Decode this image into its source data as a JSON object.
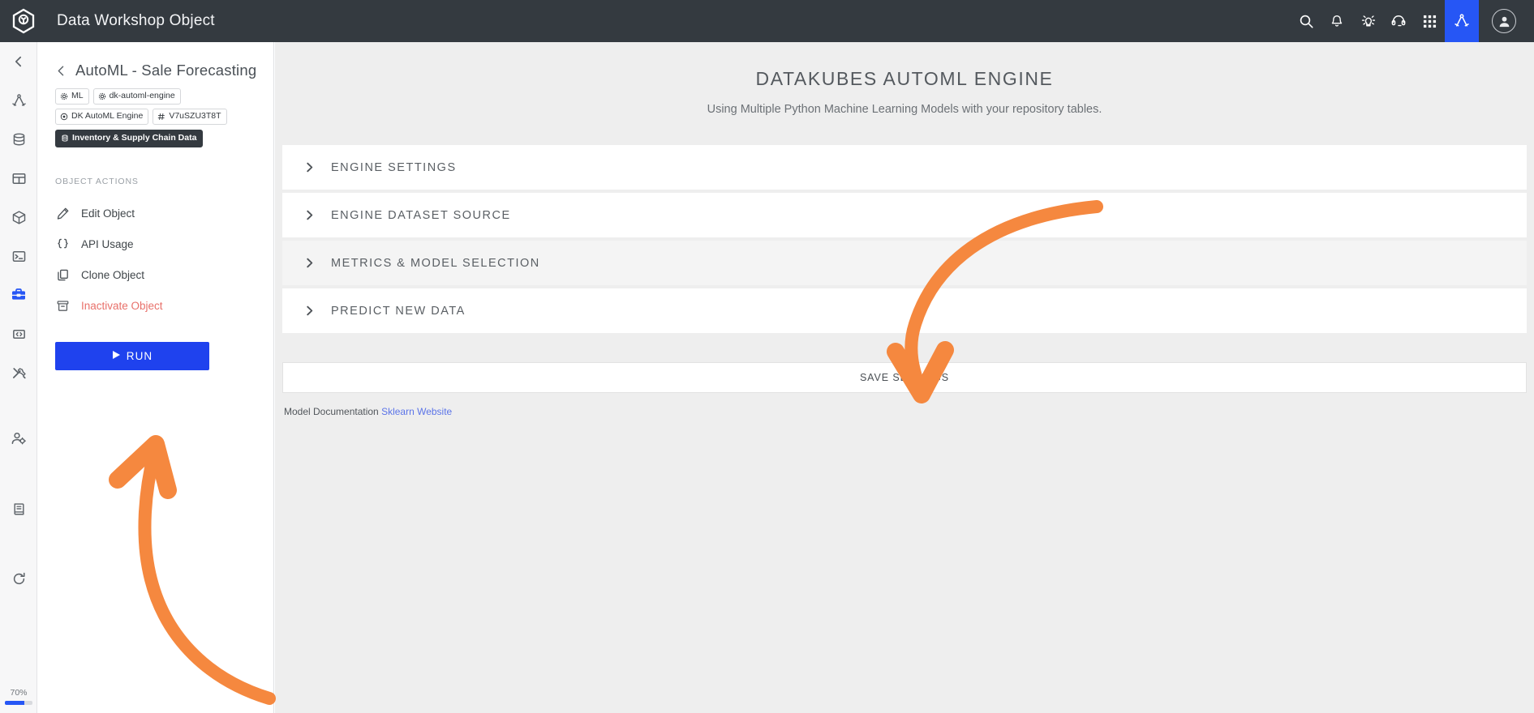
{
  "topbar": {
    "title": "Data Workshop Object",
    "logo_icon": "hexagon-logo-icon",
    "icons": [
      {
        "name": "search-icon",
        "label": "Search"
      },
      {
        "name": "bell-icon",
        "label": "Notifications"
      },
      {
        "name": "lightbulb-idea-icon",
        "label": "Ideas"
      },
      {
        "name": "headset-support-icon",
        "label": "Support"
      },
      {
        "name": "grid-apps-icon",
        "label": "Apps"
      },
      {
        "name": "compass-drafting-icon",
        "label": "Workshop"
      }
    ],
    "avatar_icon": "user-avatar-icon"
  },
  "rail": {
    "items": [
      {
        "name": "collapse-back-icon",
        "label": "Collapse"
      },
      {
        "name": "compass-drafting-icon",
        "label": "Designer"
      },
      {
        "name": "database-icon",
        "label": "Databases"
      },
      {
        "name": "table-icon",
        "label": "Tables"
      },
      {
        "name": "cube-icon",
        "label": "Objects"
      },
      {
        "name": "terminal-icon",
        "label": "Terminal"
      },
      {
        "name": "toolbox-icon",
        "label": "Workshop",
        "active": true
      },
      {
        "name": "code-brackets-icon",
        "label": "Code"
      },
      {
        "name": "tools-icon",
        "label": "Tools"
      },
      {
        "name": "user-settings-icon",
        "label": "User Settings"
      },
      {
        "name": "book-icon",
        "label": "Documentation"
      },
      {
        "name": "refresh-icon",
        "label": "Refresh"
      }
    ],
    "progress_label": "70%",
    "progress_value": 70,
    "progress_color": "#2656f5"
  },
  "panel": {
    "back_icon": "chevron-left-icon",
    "title": "AutoML - Sale Forecasting",
    "tags": [
      {
        "icon": "gear-icon",
        "label": "ML",
        "style": "light"
      },
      {
        "icon": "gear-icon",
        "label": "dk-automl-engine",
        "style": "light"
      },
      {
        "icon": "target-icon",
        "label": "DK AutoML Engine",
        "style": "light"
      },
      {
        "icon": "hash-icon",
        "label": "V7uSZU3T8T",
        "style": "light"
      },
      {
        "icon": "database-icon",
        "label": "Inventory & Supply Chain Data",
        "style": "dark"
      }
    ],
    "section_label": "OBJECT ACTIONS",
    "actions": [
      {
        "icon": "pencil-icon",
        "label": "Edit Object",
        "danger": false
      },
      {
        "icon": "braces-icon",
        "label": "API Usage",
        "danger": false
      },
      {
        "icon": "copy-icon",
        "label": "Clone Object",
        "danger": false
      },
      {
        "icon": "archive-icon",
        "label": "Inactivate Object",
        "danger": true
      }
    ],
    "run_button": {
      "label": "RUN",
      "icon": "play-icon",
      "color": "#1f42ee"
    }
  },
  "main": {
    "title": "DATAKUBES AUTOML ENGINE",
    "subtitle": "Using Multiple Python Machine Learning Models with your repository tables.",
    "accordion": [
      {
        "label": "ENGINE SETTINGS",
        "icon": "chevron-right-icon",
        "expanded": false,
        "shaded": false
      },
      {
        "label": "ENGINE DATASET SOURCE",
        "icon": "chevron-right-icon",
        "expanded": false,
        "shaded": false
      },
      {
        "label": "METRICS & MODEL SELECTION",
        "icon": "chevron-right-icon",
        "expanded": false,
        "shaded": true
      },
      {
        "label": "PREDICT NEW DATA",
        "icon": "chevron-right-icon",
        "expanded": false,
        "shaded": false
      }
    ],
    "save_button_label": "SAVE SETTINGS",
    "doc_prefix": "Model Documentation",
    "doc_link_label": "Sklearn Website",
    "doc_link_color": "#5b74e8"
  },
  "annotations": {
    "arrow_color": "#f5883f",
    "arrow_to_save_settings": "curved arrow pointing down to SAVE SETTINGS button",
    "arrow_to_run": "curved arrow pointing up to RUN button"
  }
}
